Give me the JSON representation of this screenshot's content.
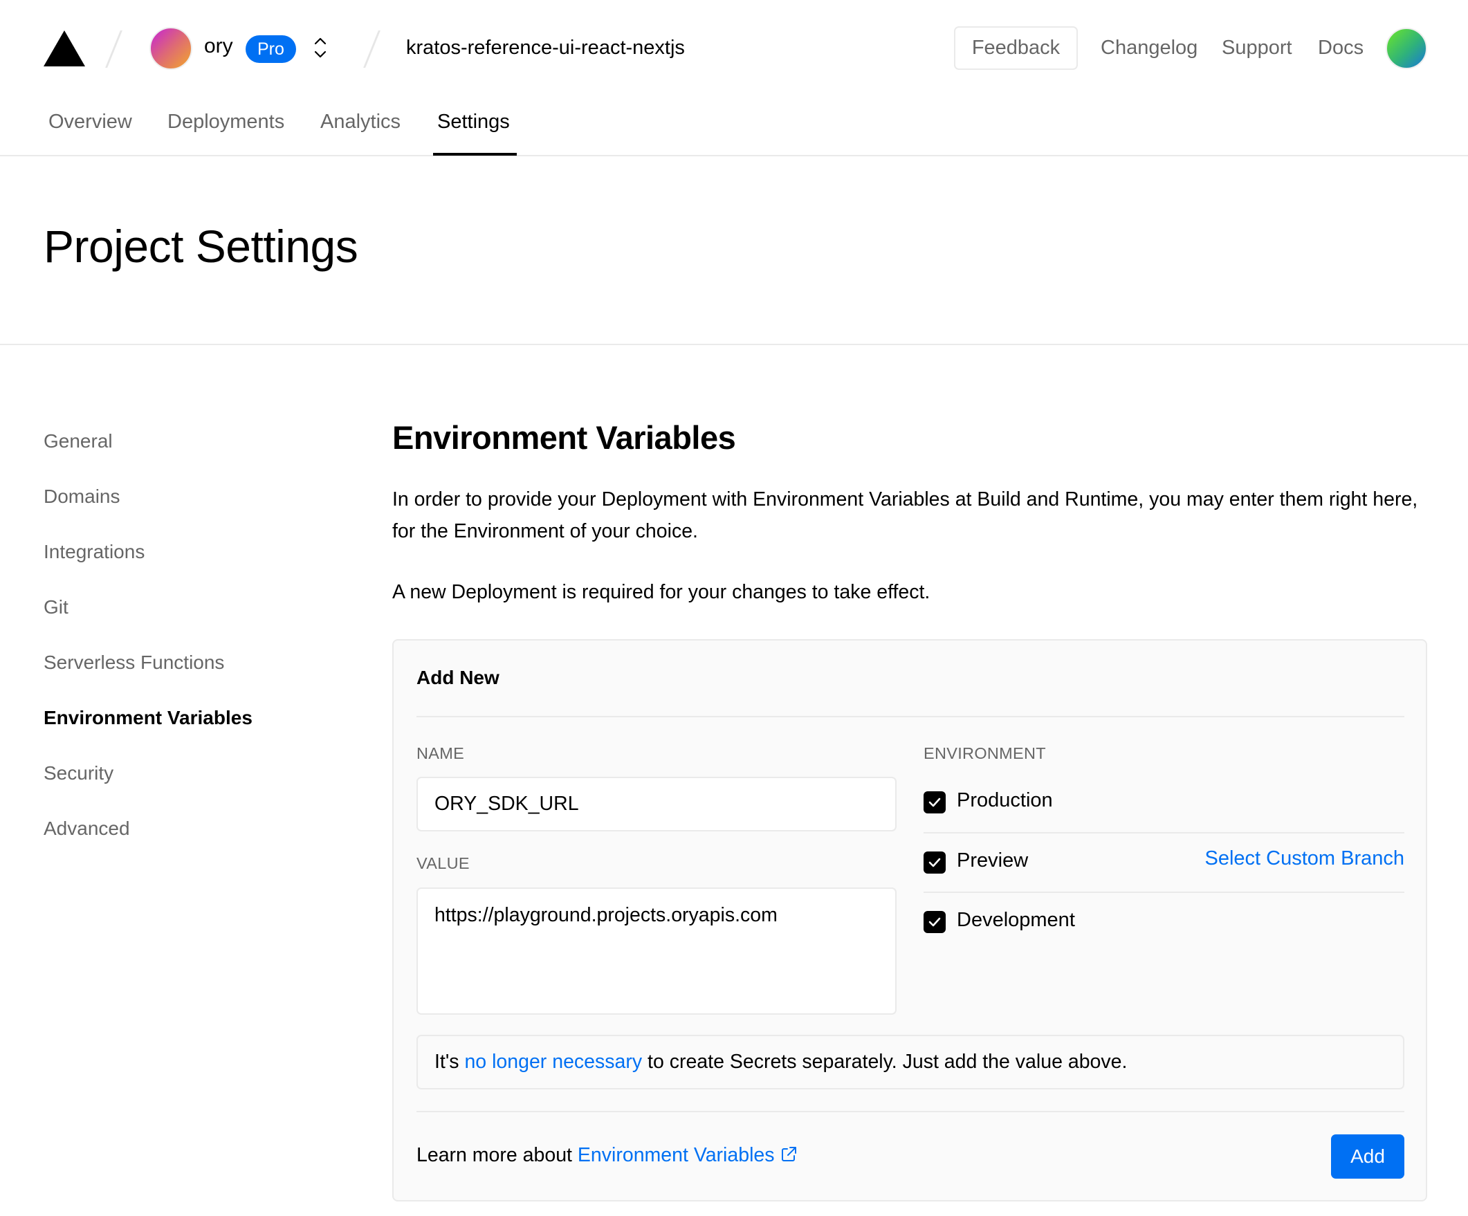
{
  "header": {
    "team": {
      "name": "ory",
      "plan_badge": "Pro"
    },
    "project_name": "kratos-reference-ui-react-nextjs",
    "feedback_label": "Feedback",
    "links": [
      "Changelog",
      "Support",
      "Docs"
    ]
  },
  "tabs": [
    {
      "label": "Overview",
      "active": false
    },
    {
      "label": "Deployments",
      "active": false
    },
    {
      "label": "Analytics",
      "active": false
    },
    {
      "label": "Settings",
      "active": true
    }
  ],
  "page_title": "Project Settings",
  "sidebar": {
    "items": [
      {
        "label": "General",
        "active": false
      },
      {
        "label": "Domains",
        "active": false
      },
      {
        "label": "Integrations",
        "active": false
      },
      {
        "label": "Git",
        "active": false
      },
      {
        "label": "Serverless Functions",
        "active": false
      },
      {
        "label": "Environment Variables",
        "active": true
      },
      {
        "label": "Security",
        "active": false
      },
      {
        "label": "Advanced",
        "active": false
      }
    ]
  },
  "main": {
    "title": "Environment Variables",
    "description": "In order to provide your Deployment with Environment Variables at Build and Runtime, you may enter them right here, for the Environment of your choice.",
    "notice": "A new Deployment is required for your changes to take effect.",
    "card": {
      "title": "Add New",
      "name_label": "NAME",
      "name_value": "ORY_SDK_URL",
      "value_label": "VALUE",
      "value_value": "https://playground.projects.oryapis.com",
      "environment_label": "ENVIRONMENT",
      "environments": [
        {
          "label": "Production",
          "checked": true
        },
        {
          "label": "Preview",
          "checked": true
        },
        {
          "label": "Development",
          "checked": true
        }
      ],
      "custom_branch_link": "Select Custom Branch",
      "secrets_note": {
        "prefix": "It's ",
        "link": "no longer necessary",
        "suffix": " to create Secrets separately. Just add the value above."
      },
      "learn_more": {
        "prefix": "Learn more about ",
        "link": "Environment Variables"
      },
      "add_button": "Add"
    }
  },
  "colors": {
    "accent": "#0070f3",
    "muted_text": "#666666",
    "border": "#eaeaea",
    "card_bg": "#fafafa"
  }
}
